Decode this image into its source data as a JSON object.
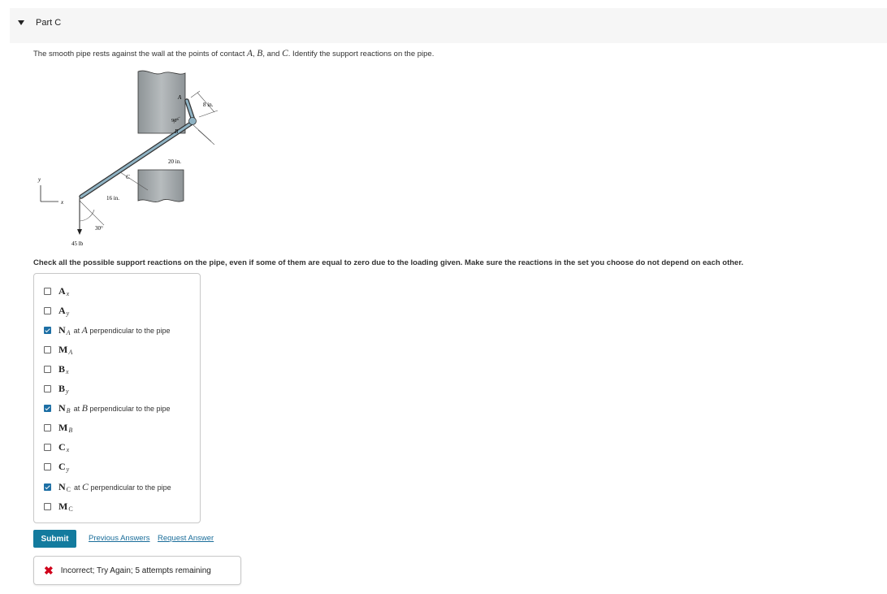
{
  "part": {
    "title": "Part C"
  },
  "question": {
    "text_before": "The smooth pipe rests against the wall at the points of contact ",
    "point_a": "A",
    "comma1": ", ",
    "point_b": "B",
    "comma2": ", and ",
    "point_c": "C",
    "text_after": ". Identify the support reactions on the pipe."
  },
  "figure": {
    "label_a": "A",
    "label_b": "B",
    "label_c": "C",
    "angle_90": "90°",
    "dim_8": "8 in.",
    "dim_20": "20 in.",
    "dim_16": "16 in.",
    "angle_30": "30°",
    "load": "45 lb",
    "axis_y": "y",
    "axis_x": "x"
  },
  "instruction": "Check all the possible support reactions on the pipe, even if some of them are equal to zero due to the loading given. Make sure the reactions in the set you choose do not depend on each other.",
  "options": [
    {
      "sym": "A",
      "sub": "x",
      "desc_pre": "",
      "desc_point": "",
      "desc_post": "",
      "checked": false
    },
    {
      "sym": "A",
      "sub": "y",
      "desc_pre": "",
      "desc_point": "",
      "desc_post": "",
      "checked": false
    },
    {
      "sym": "N",
      "sub": "A",
      "desc_pre": "at ",
      "desc_point": "A",
      "desc_post": " perpendicular to the pipe",
      "checked": true
    },
    {
      "sym": "M",
      "sub": "A",
      "desc_pre": "",
      "desc_point": "",
      "desc_post": "",
      "checked": false
    },
    {
      "sym": "B",
      "sub": "x",
      "desc_pre": "",
      "desc_point": "",
      "desc_post": "",
      "checked": false
    },
    {
      "sym": "B",
      "sub": "y",
      "desc_pre": "",
      "desc_point": "",
      "desc_post": "",
      "checked": false
    },
    {
      "sym": "N",
      "sub": "B",
      "desc_pre": "at ",
      "desc_point": "B",
      "desc_post": " perpendicular to the pipe",
      "checked": true
    },
    {
      "sym": "M",
      "sub": "B",
      "desc_pre": "",
      "desc_point": "",
      "desc_post": "",
      "checked": false
    },
    {
      "sym": "C",
      "sub": "x",
      "desc_pre": "",
      "desc_point": "",
      "desc_post": "",
      "checked": false
    },
    {
      "sym": "C",
      "sub": "y",
      "desc_pre": "",
      "desc_point": "",
      "desc_post": "",
      "checked": false
    },
    {
      "sym": "N",
      "sub": "C",
      "desc_pre": "at ",
      "desc_point": "C",
      "desc_post": " perpendicular to the pipe",
      "checked": true
    },
    {
      "sym": "M",
      "sub": "C",
      "desc_pre": "",
      "desc_point": "",
      "desc_post": "",
      "checked": false
    }
  ],
  "actions": {
    "submit": "Submit",
    "previous_answers": "Previous Answers",
    "request_answer": "Request Answer"
  },
  "feedback": {
    "icon": "x-icon",
    "text": "Incorrect; Try Again; 5 attempts remaining"
  }
}
